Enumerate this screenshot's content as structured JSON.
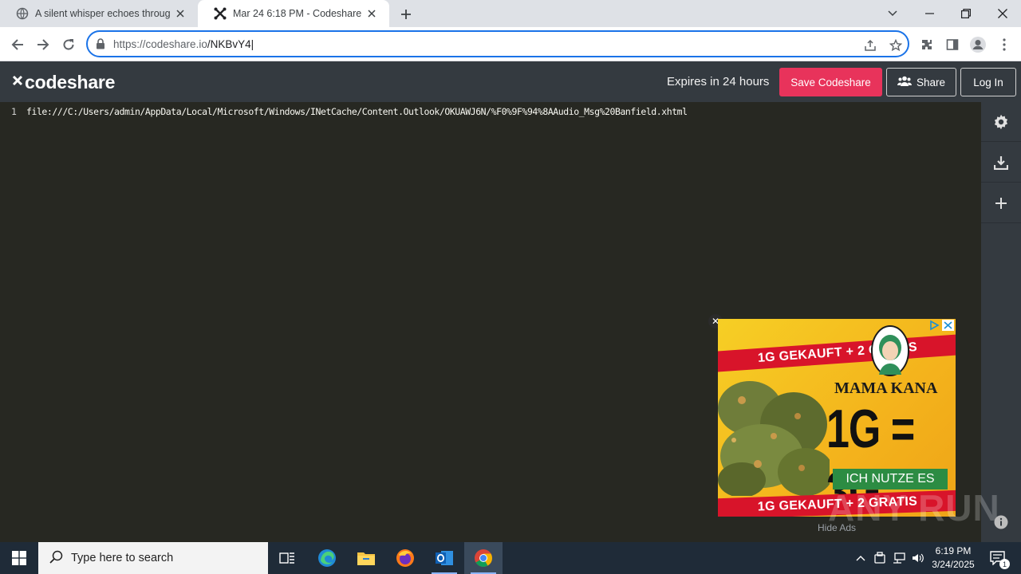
{
  "browser": {
    "tabs": [
      {
        "title": "A silent whisper echoes through the",
        "active": false
      },
      {
        "title": "Mar 24 6:18 PM - Codeshare",
        "active": true
      }
    ],
    "url_host": "https://codeshare.io",
    "url_path": "/NKBvY4"
  },
  "codeshare": {
    "logo": "codeshare",
    "expires": "Expires in 24 hours",
    "save_label": "Save Codeshare",
    "share_label": "Share",
    "login_label": "Log In",
    "accent_color": "#e8335b"
  },
  "editor": {
    "lines": [
      {
        "number": "1",
        "text": "file:///C:/Users/admin/AppData/Local/Microsoft/Windows/INetCache/Content.Outlook/OKUAWJ6N/%F0%9F%94%8AAudio_Msg%20Banfield.xhtml"
      }
    ],
    "sidebar_icons": [
      "gear-icon",
      "download-icon",
      "plus-icon",
      "info-icon"
    ]
  },
  "ad": {
    "band_top": "1G GEKAUFT + 2 GRATIS",
    "brand": "MAMA KANA",
    "headline": "1G = 3G",
    "cta": "ICH NUTZE ES",
    "band_bottom": "1G GEKAUFT + 2 GRATIS",
    "hide_ads": "Hide Ads"
  },
  "watermark": "ANY RUN",
  "taskbar": {
    "search_placeholder": "Type here to search",
    "time": "6:19 PM",
    "date": "3/24/2025",
    "notification_count": "1"
  }
}
